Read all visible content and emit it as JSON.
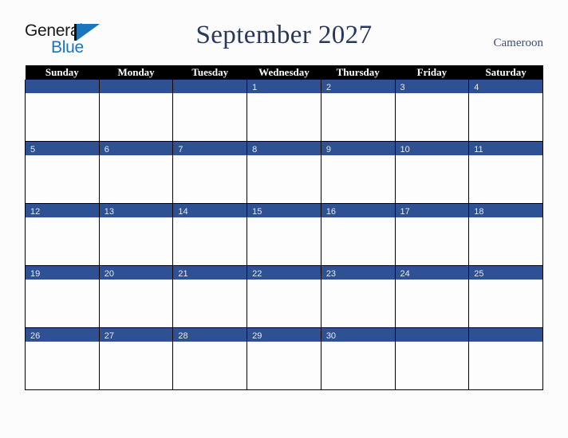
{
  "brand": {
    "name_part1": "General",
    "name_part2": "Blue",
    "flag_icon": "blue-flag-triangle-icon",
    "colors": {
      "general_text": "#1a1a1a",
      "blue_text": "#1b75bc",
      "flag": "#1b75bc"
    }
  },
  "header": {
    "title": "September 2027",
    "country": "Cameroon",
    "title_color": "#28385c",
    "country_color": "#3d4f77"
  },
  "calendar": {
    "month": "September",
    "year": "2027",
    "weekday_headers": [
      "Sunday",
      "Monday",
      "Tuesday",
      "Wednesday",
      "Thursday",
      "Friday",
      "Saturday"
    ],
    "header_bg": "#000000",
    "header_text_color": "#ffffff",
    "date_band_color": "#2d5193",
    "date_text_color": "#e8eaf0",
    "cell_bg": "#fdfdfd",
    "grid_line_color": "#000000",
    "weeks": [
      [
        "",
        "",
        "",
        "1",
        "2",
        "3",
        "4"
      ],
      [
        "5",
        "6",
        "7",
        "8",
        "9",
        "10",
        "11"
      ],
      [
        "12",
        "13",
        "14",
        "15",
        "16",
        "17",
        "18"
      ],
      [
        "19",
        "20",
        "21",
        "22",
        "23",
        "24",
        "25"
      ],
      [
        "26",
        "27",
        "28",
        "29",
        "30",
        "",
        ""
      ]
    ]
  },
  "page": {
    "background": "#fcfcfc"
  }
}
